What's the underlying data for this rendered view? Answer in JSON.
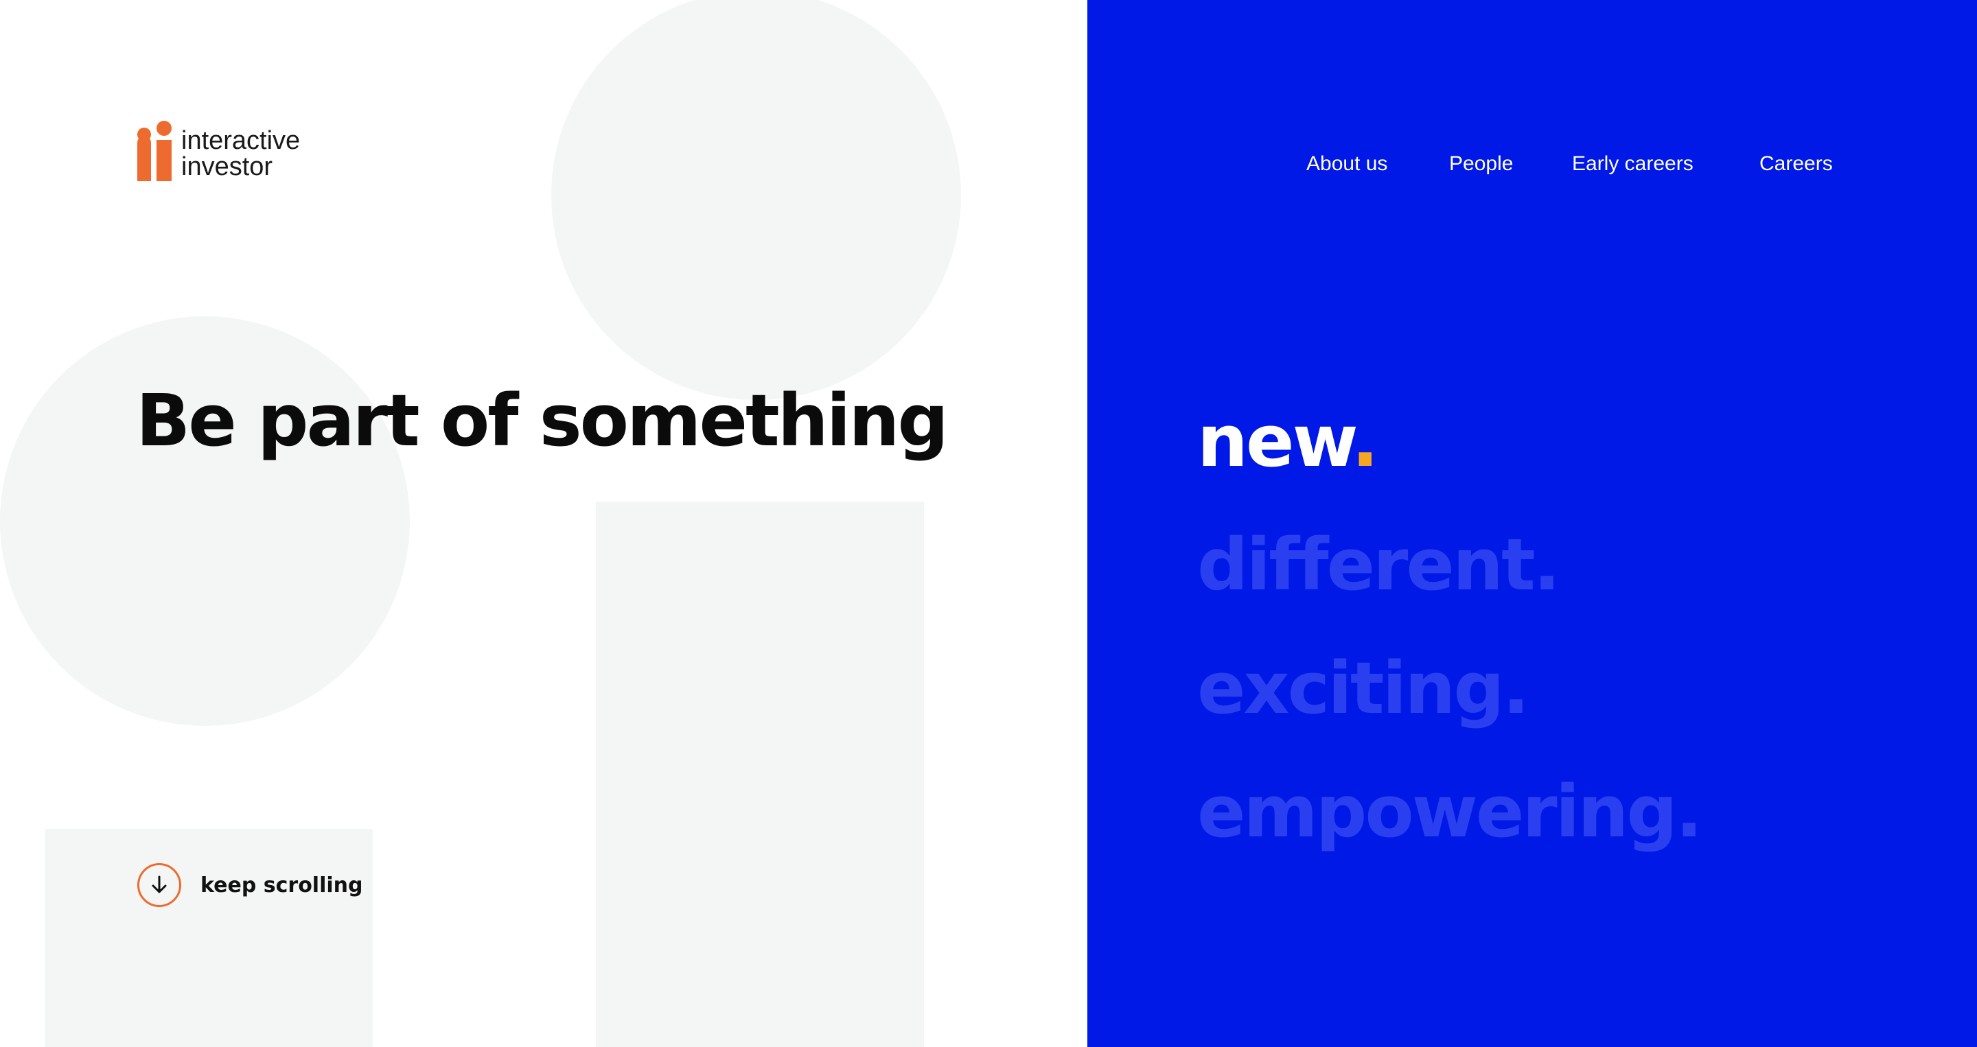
{
  "brand": {
    "line1": "interactive",
    "line2": "investor",
    "accent_color": "#ee6b2f"
  },
  "hero": {
    "headline": "Be part of something",
    "words": [
      {
        "text": "new",
        "period": "."
      },
      {
        "text": "different",
        "period": "."
      },
      {
        "text": "exciting",
        "period": "."
      },
      {
        "text": "empowering",
        "period": "."
      }
    ],
    "panel_color": "#0019e6"
  },
  "nav": {
    "items": [
      {
        "label": "About us"
      },
      {
        "label": "People"
      },
      {
        "label": "Early careers"
      },
      {
        "label": "Careers"
      }
    ]
  },
  "scroll": {
    "label": "keep scrolling",
    "icon": "arrow-down-icon"
  }
}
